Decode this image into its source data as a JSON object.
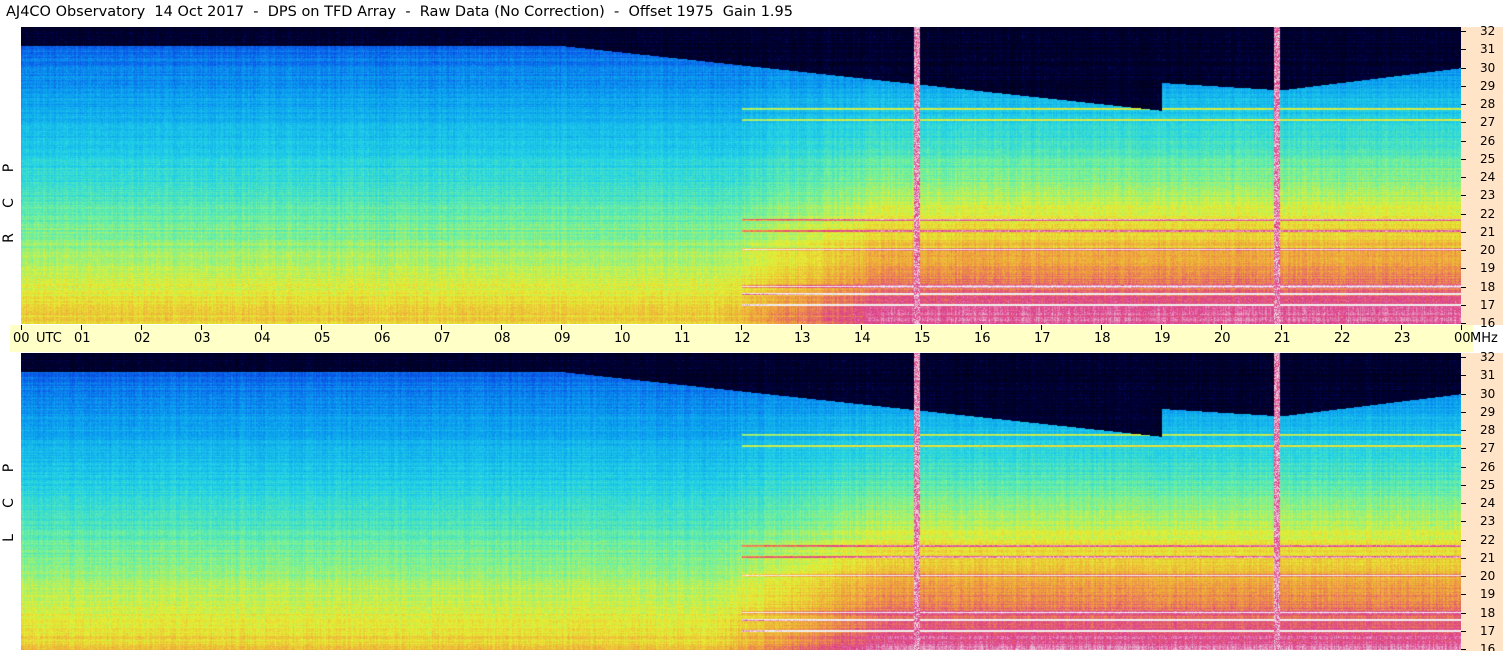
{
  "title": "AJ4CO Observatory  14 Oct 2017  -  DPS on TFD Array  -  Raw Data (No Correction)  -  Offset 1975  Gain 1.95",
  "time_axis": {
    "labels": [
      "00",
      "01",
      "02",
      "03",
      "04",
      "05",
      "06",
      "07",
      "08",
      "09",
      "10",
      "11",
      "12",
      "13",
      "14",
      "15",
      "16",
      "17",
      "18",
      "19",
      "20",
      "21",
      "22",
      "23",
      "00"
    ],
    "unit": "UTC"
  },
  "freq_axis": {
    "labels": [
      "32",
      "31",
      "30",
      "29",
      "28",
      "27",
      "26",
      "25",
      "24",
      "23",
      "22",
      "21",
      "20",
      "19",
      "18",
      "17",
      "16"
    ],
    "unit": "MHz"
  },
  "panels": [
    {
      "id": "rcp",
      "label": [
        "R",
        "C",
        "P"
      ]
    },
    {
      "id": "lcp",
      "label": [
        "L",
        "C",
        "P"
      ]
    }
  ],
  "colors": {
    "axis_bg": "#ffe4c8",
    "timebar_bg": "#ffffc8",
    "colormap": [
      "#000010",
      "#00003c",
      "#0a1f96",
      "#0a50e6",
      "#0a9ef0",
      "#22d2e6",
      "#6ef0a0",
      "#e6f032",
      "#f0a03c",
      "#dc3c8c",
      "#f0f0f0"
    ]
  },
  "chart_data": {
    "type": "heatmap",
    "title": "AJ4CO Observatory  14 Oct 2017  -  DPS on TFD Array  -  Raw Data (No Correction)  -  Offset 1975  Gain 1.95",
    "x_unit": "UTC",
    "x_range": [
      0,
      24
    ],
    "y_unit": "MHz",
    "y_range": [
      16,
      32
    ],
    "panels": [
      "RCP",
      "LCP"
    ],
    "bright_vertical_bursts_utc": [
      14.93,
      20.93
    ],
    "persistent_emission_bands_mhz": [
      17.0,
      17.6,
      18.0,
      20.0,
      21.0,
      21.6,
      27.0,
      27.6
    ]
  }
}
